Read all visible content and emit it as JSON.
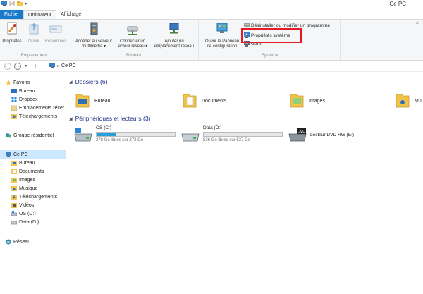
{
  "window": {
    "title": "Ce PC"
  },
  "tabs": {
    "file": "Fichier",
    "computer": "Ordinateur",
    "view": "Affichage"
  },
  "ribbon": {
    "emplacement": {
      "label": "Emplacement",
      "properties": "Propriétés",
      "open": "Ouvrir",
      "rename": "Renommer"
    },
    "reseau": {
      "label": "Réseau",
      "media_server_l1": "Accéder au serveur",
      "media_server_l2": "multimédia ▾",
      "map_drive_l1": "Connecter un",
      "map_drive_l2": "lecteur réseau ▾",
      "add_location_l1": "Ajouter un",
      "add_location_l2": "emplacement réseau"
    },
    "systeme": {
      "label": "Système",
      "control_panel_l1": "Ouvrir le Panneau",
      "control_panel_l2": "de configuration",
      "uninstall": "Désinstaller ou modifier un programme",
      "system_properties": "Propriétés système",
      "manage": "Gérer"
    }
  },
  "address": {
    "path": "Ce PC"
  },
  "nav": {
    "favorites": "Favoris",
    "fav_items": [
      "Bureau",
      "Dropbox",
      "Emplacements récer",
      "Téléchargements"
    ],
    "homegroup": "Groupe résidentiel",
    "this_pc": "Ce PC",
    "pc_items": [
      "Bureau",
      "Documents",
      "Images",
      "Musique",
      "Téléchargements",
      "Vidéos",
      "OS (C:)",
      "Data (D:)"
    ],
    "network": "Réseau"
  },
  "content": {
    "folders_title": "Dossiers (6)",
    "folders": [
      "Bureau",
      "Documents",
      "Images",
      "Mu"
    ],
    "devices_title": "Périphériques et lecteurs (3)",
    "drives": [
      {
        "name": "OS (C:)",
        "free": "278 Go libres sur 372 Go",
        "used_fraction": 0.25
      },
      {
        "name": "Data (D:)",
        "free": "536 Go libres sur 537 Go",
        "used_fraction": 0.0
      }
    ],
    "dvd": "Lecteur DVD RW (E:)"
  }
}
